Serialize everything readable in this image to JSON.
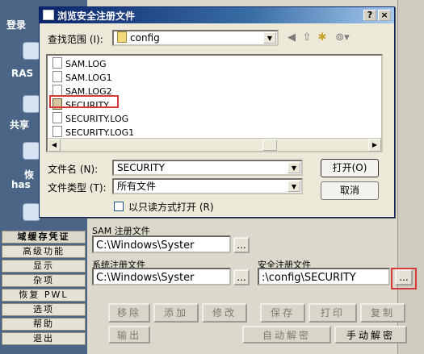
{
  "sidebar": {
    "labels": [
      "登录",
      "RAS",
      "共享",
      "恢",
      "has"
    ],
    "buttons": [
      "域缓存凭证",
      "高级功能",
      "显示",
      "杂项",
      "恢复 PWL",
      "选项",
      "帮助",
      "退出"
    ]
  },
  "background": {
    "sam_label": "SAM 注册文件",
    "sam_value": "C:\\Windows\\Syster",
    "system_label": "系统注册文件",
    "system_value": "C:\\Windows\\Syster",
    "security_label": "安全注册文件",
    "security_value": ":\\config\\SECURITY",
    "browse_label": "...",
    "action_buttons": [
      "移除",
      "添加",
      "修改",
      "保存",
      "打印",
      "复制"
    ],
    "output_button": "输出",
    "auto_decrypt_button": "自动解密",
    "manual_decrypt_button": "手动解密"
  },
  "dialog": {
    "title": "浏览安全注册文件",
    "help_button": "?",
    "close_button": "×",
    "look_in_label": "查找范围 (I):",
    "look_in_value": "config",
    "files": [
      "SAM.LOG",
      "SAM.LOG1",
      "SAM.LOG2",
      "SECURITY",
      "SECURITY.LOG",
      "SECURITY.LOG1"
    ],
    "selected_file": "SECURITY",
    "filename_label": "文件名 (N):",
    "filename_value": "SECURITY",
    "filetype_label": "文件类型 (T):",
    "filetype_value": "所有文件",
    "readonly_label": "以只读方式打开 (R)",
    "open_button": "打开(O)",
    "cancel_button": "取消"
  },
  "colors": {
    "highlight": "#d83a3a",
    "titlebar": "#0a246a"
  }
}
